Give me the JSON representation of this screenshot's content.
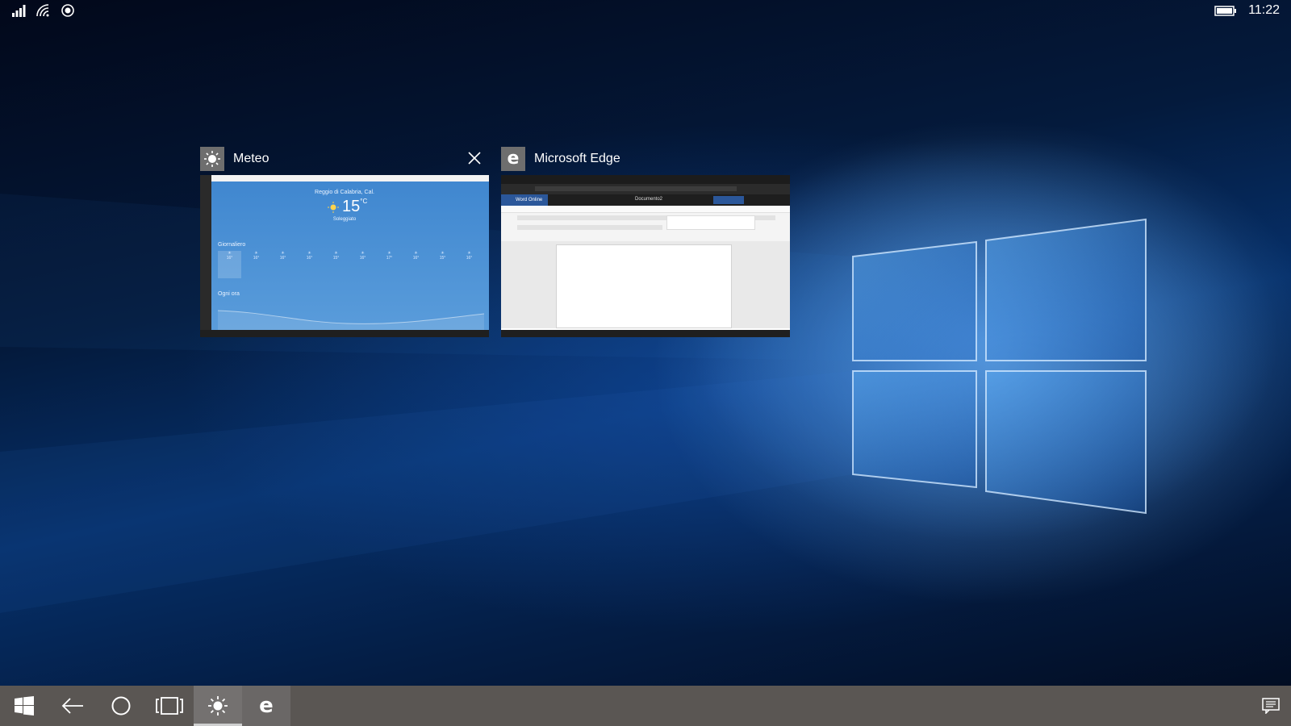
{
  "status_bar": {
    "icons_left": [
      "signal-strength-icon",
      "wifi-icon",
      "location-icon"
    ],
    "icons_right": [
      "battery-icon"
    ],
    "time": "11:22"
  },
  "task_view": {
    "windows": [
      {
        "app_name": "Meteo",
        "icon": "sun-icon",
        "close_icon": "close-icon",
        "preview": {
          "city": "Reggio di Calabria, Cal.",
          "temperature": "15",
          "unit": "°C",
          "condition": "Soleggiato",
          "daily_label": "Giornaliero",
          "days": [
            "16°",
            "16°",
            "16°",
            "16°",
            "15°",
            "16°",
            "17°",
            "16°",
            "15°",
            "16°"
          ],
          "hourly_label": "Ogni ora"
        }
      },
      {
        "app_name": "Microsoft Edge",
        "icon": "edge-icon",
        "preview": {
          "app_label": "Word Online",
          "doc_title": "Documento2"
        }
      }
    ]
  },
  "taskbar": {
    "buttons": [
      {
        "name": "start",
        "icon": "windows-logo-icon"
      },
      {
        "name": "back",
        "icon": "back-arrow-icon"
      },
      {
        "name": "search",
        "icon": "cortana-circle-icon"
      },
      {
        "name": "task-view",
        "icon": "task-view-icon"
      },
      {
        "name": "meteo",
        "icon": "sun-icon",
        "active": true
      },
      {
        "name": "edge",
        "icon": "edge-icon"
      }
    ],
    "action_center_icon": "action-center-icon"
  }
}
